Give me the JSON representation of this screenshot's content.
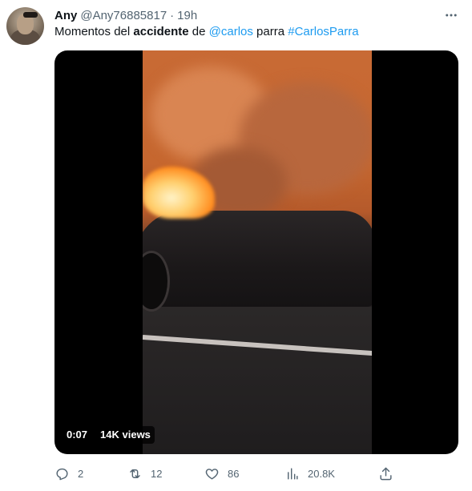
{
  "tweet": {
    "author_name": "Any",
    "handle": "@Any76885817",
    "separator": "·",
    "time": "19h",
    "text": {
      "part1": "Momentos del ",
      "bold": "accidente",
      "part2": " de ",
      "mention": "@carlos",
      "part3": " parra ",
      "hashtag": "#CarlosParra"
    }
  },
  "media": {
    "duration": "0:07",
    "views": "14K views"
  },
  "actions": {
    "replies": "2",
    "retweets": "12",
    "likes": "86",
    "views": "20.8K"
  },
  "icons": {
    "more": "more-icon",
    "reply": "reply-icon",
    "retweet": "retweet-icon",
    "like": "heart-icon",
    "views": "views-icon",
    "share": "share-icon"
  },
  "colors": {
    "link": "#1d9bf0",
    "secondary_text": "#536471",
    "primary_text": "#0f1419"
  }
}
